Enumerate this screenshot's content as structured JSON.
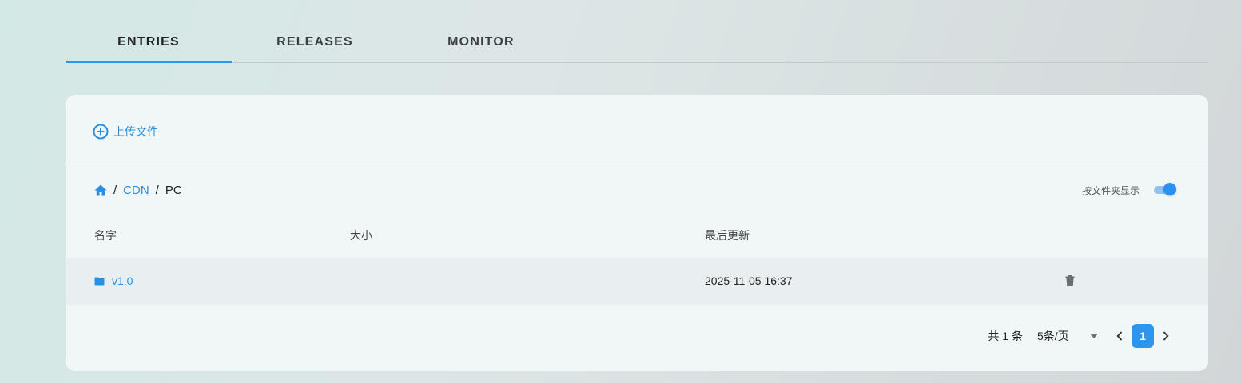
{
  "tabs": [
    {
      "label": "ENTRIES",
      "active": true
    },
    {
      "label": "RELEASES",
      "active": false
    },
    {
      "label": "MONITOR",
      "active": false
    }
  ],
  "toolbar": {
    "upload_label": "上传文件",
    "upload_icon": "plus-circle-icon"
  },
  "breadcrumb": {
    "home_icon": "home-icon",
    "separator": "/",
    "items": [
      "CDN",
      "PC"
    ]
  },
  "folder_view": {
    "label": "按文件夹显示",
    "enabled": true
  },
  "table": {
    "columns": [
      "名字",
      "大小",
      "最后更新"
    ],
    "rows": [
      {
        "type": "folder",
        "name": "v1.0",
        "size": "",
        "updated": "2025-11-05 16:37",
        "icon": "folder-icon",
        "action_icon": "trash-icon"
      }
    ]
  },
  "pagination": {
    "total": "共 1 条",
    "page_size": "5条/页",
    "current_page": "1"
  },
  "colors": {
    "accent": "#2d95ec",
    "link": "#2a8fe0",
    "card_bg": "#f1f6f6",
    "row_bg": "#e9eff1"
  }
}
